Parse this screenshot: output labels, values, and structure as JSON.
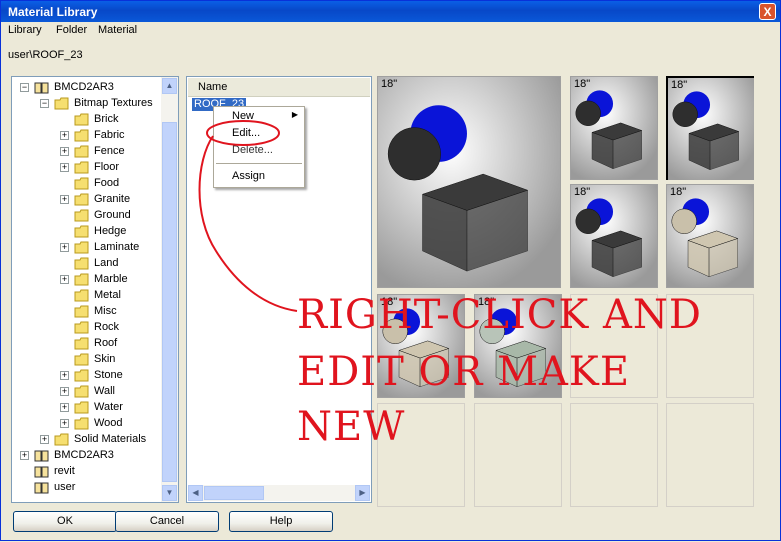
{
  "window": {
    "title": "Material Library",
    "close_label": "X"
  },
  "menu": [
    "Library",
    "Folder",
    "Material"
  ],
  "path": "user\\ROOF_23",
  "tree": [
    {
      "label": "BMCD2AR3",
      "depth": 0,
      "expander": "−",
      "icon": "book-icon"
    },
    {
      "label": "Bitmap Textures",
      "depth": 1,
      "expander": "−",
      "icon": "folder-icon"
    },
    {
      "label": "Brick",
      "depth": 2,
      "expander": "",
      "icon": "folder-icon"
    },
    {
      "label": "Fabric",
      "depth": 2,
      "expander": "+",
      "icon": "folder-icon"
    },
    {
      "label": "Fence",
      "depth": 2,
      "expander": "+",
      "icon": "folder-icon"
    },
    {
      "label": "Floor",
      "depth": 2,
      "expander": "+",
      "icon": "folder-icon"
    },
    {
      "label": "Food",
      "depth": 2,
      "expander": "",
      "icon": "folder-icon"
    },
    {
      "label": "Granite",
      "depth": 2,
      "expander": "+",
      "icon": "folder-icon"
    },
    {
      "label": "Ground",
      "depth": 2,
      "expander": "",
      "icon": "folder-icon"
    },
    {
      "label": "Hedge",
      "depth": 2,
      "expander": "",
      "icon": "folder-icon"
    },
    {
      "label": "Laminate",
      "depth": 2,
      "expander": "+",
      "icon": "folder-icon"
    },
    {
      "label": "Land",
      "depth": 2,
      "expander": "",
      "icon": "folder-icon"
    },
    {
      "label": "Marble",
      "depth": 2,
      "expander": "+",
      "icon": "folder-icon"
    },
    {
      "label": "Metal",
      "depth": 2,
      "expander": "",
      "icon": "folder-icon"
    },
    {
      "label": "Misc",
      "depth": 2,
      "expander": "",
      "icon": "folder-icon"
    },
    {
      "label": "Rock",
      "depth": 2,
      "expander": "",
      "icon": "folder-icon"
    },
    {
      "label": "Roof",
      "depth": 2,
      "expander": "",
      "icon": "folder-icon"
    },
    {
      "label": "Skin",
      "depth": 2,
      "expander": "",
      "icon": "folder-icon"
    },
    {
      "label": "Stone",
      "depth": 2,
      "expander": "+",
      "icon": "folder-icon"
    },
    {
      "label": "Wall",
      "depth": 2,
      "expander": "+",
      "icon": "folder-icon"
    },
    {
      "label": "Water",
      "depth": 2,
      "expander": "+",
      "icon": "folder-icon"
    },
    {
      "label": "Wood",
      "depth": 2,
      "expander": "+",
      "icon": "folder-icon"
    },
    {
      "label": "Solid Materials",
      "depth": 1,
      "expander": "+",
      "icon": "folder-icon"
    },
    {
      "label": "BMCD2AR3",
      "depth": 0,
      "expander": "+",
      "icon": "book-icon"
    },
    {
      "label": "revit",
      "depth": 0,
      "expander": "",
      "icon": "book-icon"
    },
    {
      "label": "user",
      "depth": 0,
      "expander": "",
      "icon": "book-icon"
    }
  ],
  "list": {
    "header": "Name",
    "items": [
      "ROOF_23"
    ]
  },
  "context_menu": {
    "items": [
      "New",
      "Edit...",
      "Delete...",
      "Assign"
    ]
  },
  "thumbnails": [
    {
      "size": "18\"",
      "material": "dark-stone",
      "selected": false
    },
    {
      "size": "18\"",
      "material": "dark-stone",
      "selected": false
    },
    {
      "size": "18\"",
      "material": "dark-stone",
      "selected": true
    },
    {
      "size": "18\"",
      "material": "dark-stone",
      "selected": false
    },
    {
      "size": "18\"",
      "material": "light-stone",
      "selected": false
    },
    {
      "size": "18\"",
      "material": "light-stone",
      "selected": false
    },
    {
      "size": "18\"",
      "material": "green-stone",
      "selected": false
    }
  ],
  "buttons": {
    "ok": "OK",
    "cancel": "Cancel",
    "help": "Help"
  },
  "annotation": [
    "RIGHT-CLICK AND",
    "EDIT OR MAKE",
    "NEW"
  ],
  "colors": {
    "accent": "#0a5fe6",
    "annotation": "#e0141e",
    "selection": "#316ac5",
    "sphere": "#0a14d8"
  }
}
